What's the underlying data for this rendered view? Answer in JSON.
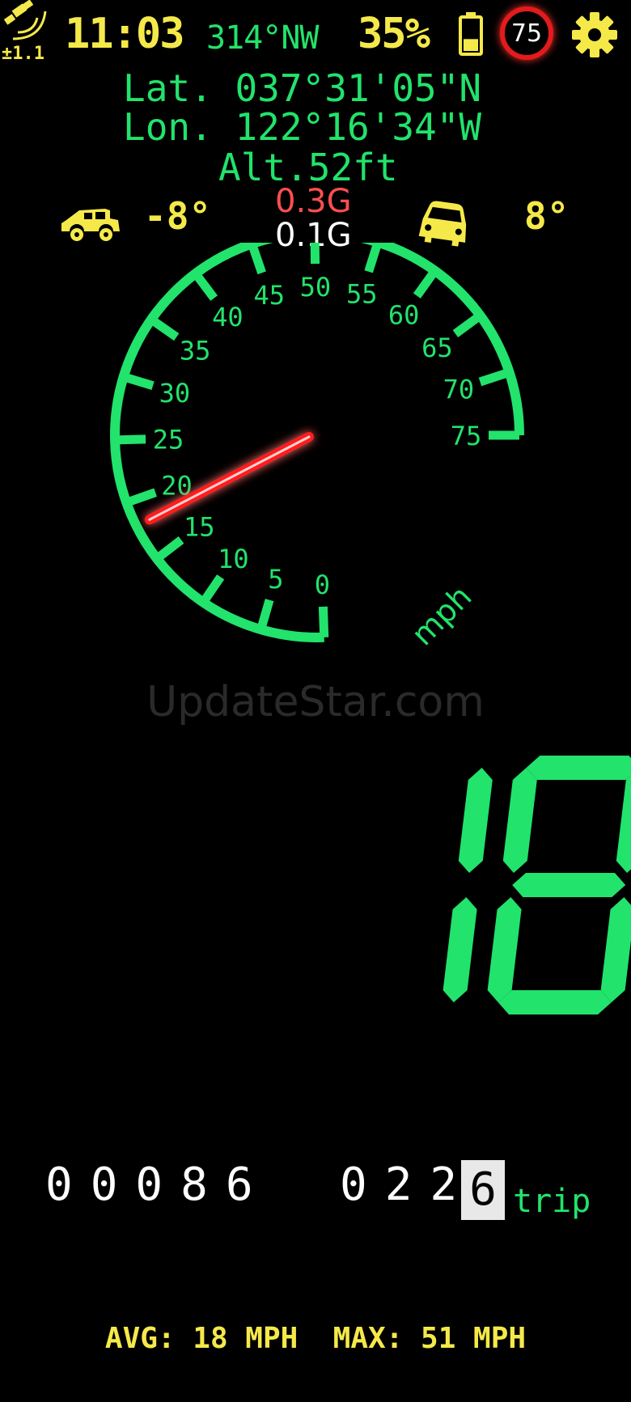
{
  "status": {
    "gps_accuracy": "±1.1",
    "time": "11:03",
    "heading": "314°NW",
    "battery_percent": "35%",
    "battery_level": 0.35,
    "speed_limit": "75",
    "icons": [
      "satellite-icon",
      "battery-icon",
      "gear-icon"
    ]
  },
  "location": {
    "lat": "Lat. 037°31'05\"N",
    "lon": "Lon. 122°16'34\"W",
    "alt": "Alt.52ft"
  },
  "tilt": {
    "pitch": "-8°",
    "roll": "8°",
    "g_lateral": "0.3G",
    "g_longitudinal": "0.1G",
    "icons": [
      "car-side-icon",
      "car-front-icon"
    ]
  },
  "gauge": {
    "labels": [
      "0",
      "5",
      "10",
      "15",
      "20",
      "25",
      "30",
      "35",
      "40",
      "45",
      "50",
      "55",
      "60",
      "65",
      "70",
      "75"
    ],
    "unit": "mph",
    "min": 0,
    "max": 75,
    "speed": 18
  },
  "watermark": "UpdateStar.com",
  "digital_speed": "18",
  "odometer": {
    "total": "00086",
    "trip_main": "022",
    "trip_last": "6",
    "trip_label": "trip"
  },
  "stats": {
    "text": "AVG: 18 MPH  MAX: 51 MPH"
  },
  "colors": {
    "green": "#22e36b",
    "yellow": "#f5e94a",
    "needle": "#ff1a1a",
    "limit_ring": "#e31b1b"
  }
}
